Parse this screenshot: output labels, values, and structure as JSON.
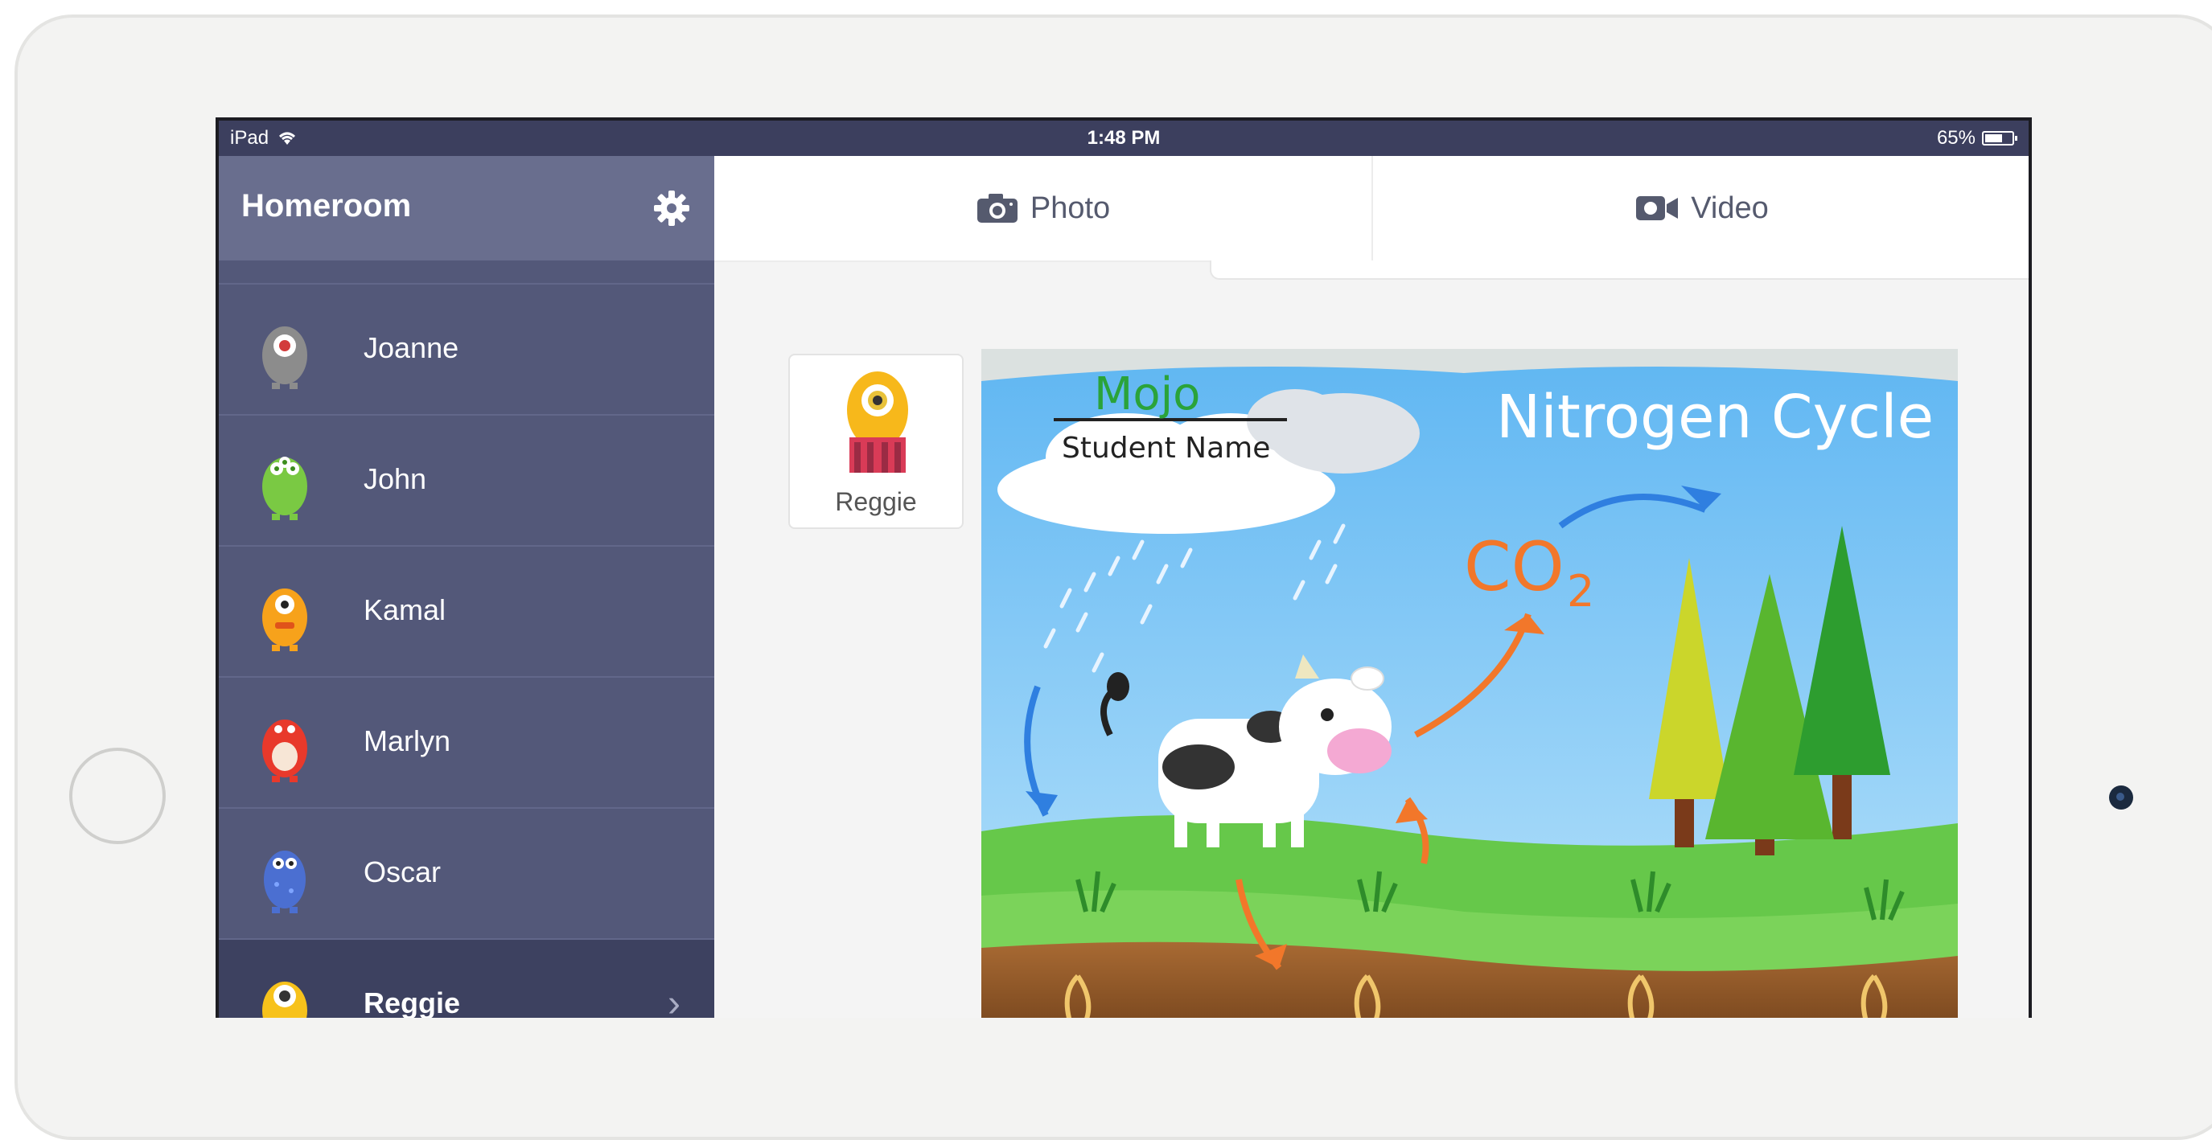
{
  "statusbar": {
    "device": "iPad",
    "time": "1:48 PM",
    "battery": "65%",
    "battery_level": 0.65
  },
  "sidebar": {
    "title": "Homeroom",
    "students": [
      {
        "name": "Joanne",
        "color": "#8c8c8c",
        "accent": "#d23b3b"
      },
      {
        "name": "John",
        "color": "#7ac943",
        "accent": "#3d8d1e"
      },
      {
        "name": "Kamal",
        "color": "#f7a21b",
        "accent": "#e0531a"
      },
      {
        "name": "Marlyn",
        "color": "#e8392b",
        "accent": "#f7e6d6"
      },
      {
        "name": "Oscar",
        "color": "#4b6fd1",
        "accent": "#7ea4ff"
      },
      {
        "name": "Reggie",
        "color": "#f7c21b",
        "accent": "#e23b3b"
      }
    ]
  },
  "toolbar": {
    "photo_label": "Photo",
    "video_label": "Video"
  },
  "selected_student": {
    "name": "Reggie"
  },
  "artwork": {
    "label_name": "Mojo",
    "label_caption": "Student Name",
    "title": "Nitrogen Cycle",
    "formula_main": "CO",
    "formula_sub": "2"
  }
}
